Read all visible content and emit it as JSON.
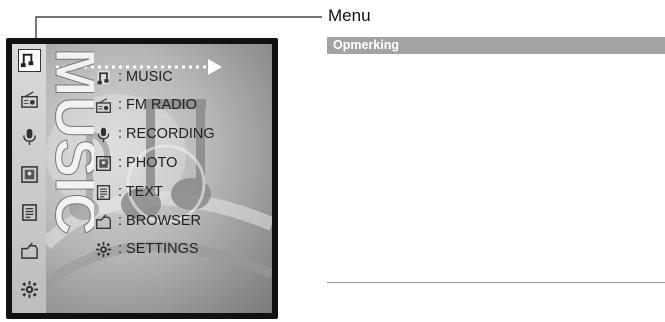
{
  "callout_label": "Menu",
  "panel": {
    "header": "Opmerking",
    "items": [
      {
        "icon": "music-icon",
        "label": ": MUSIC"
      },
      {
        "icon": "fm-radio-icon",
        "label": ": FM RADIO"
      },
      {
        "icon": "recording-icon",
        "label": ": RECORDING"
      },
      {
        "icon": "photo-icon",
        "label": ": PHOTO"
      },
      {
        "icon": "text-icon",
        "label": ": TEXT"
      },
      {
        "icon": "browser-icon",
        "label": ": BROWSER"
      },
      {
        "icon": "settings-icon",
        "label": ": SETTINGS"
      }
    ]
  },
  "screen": {
    "art_word": "MUSIC",
    "side_icons": [
      "music-icon",
      "fm-radio-icon",
      "recording-icon",
      "photo-icon",
      "text-icon",
      "browser-icon",
      "settings-icon"
    ],
    "active_icon": "music-icon"
  },
  "colors": {
    "panel_header_bg": "#a3a3a3",
    "screen_frame": "#111111"
  }
}
